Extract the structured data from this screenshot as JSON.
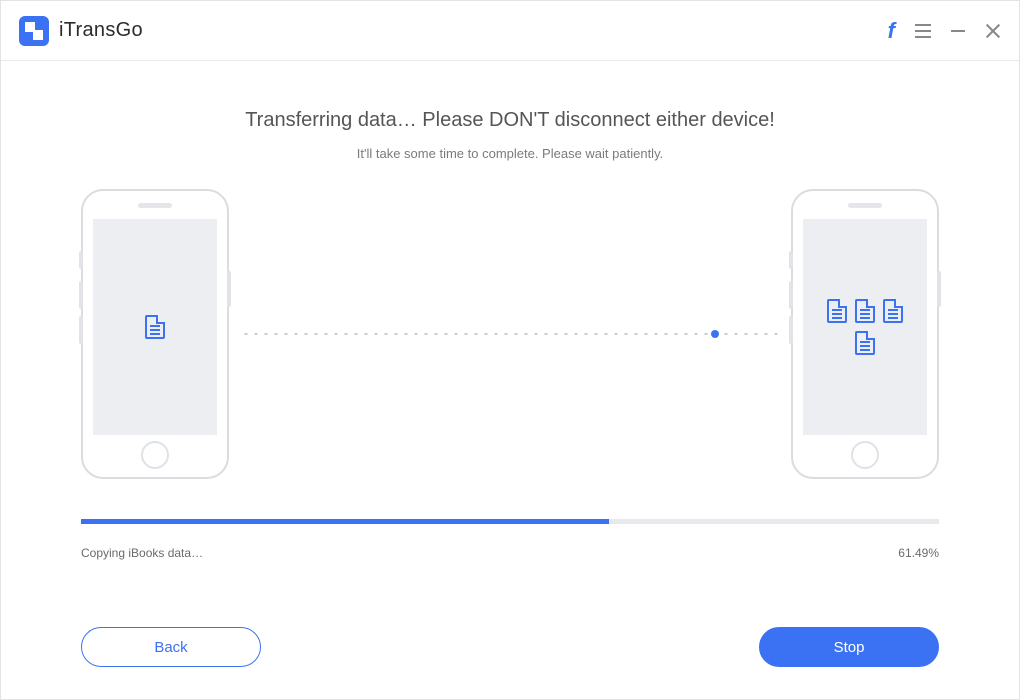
{
  "app": {
    "title": "iTransGo"
  },
  "titlebar_icons": {
    "facebook": "facebook",
    "menu": "menu",
    "minimize": "minimize",
    "close": "close"
  },
  "main": {
    "heading": "Transferring data… Please DON'T disconnect either device!",
    "subheading": "It'll take some time to complete. Please wait patiently."
  },
  "progress": {
    "status_text": "Copying iBooks data…",
    "percent_value": 61.49,
    "percent_text": "61.49%",
    "fill_width": "61.49%"
  },
  "buttons": {
    "back": "Back",
    "stop": "Stop"
  },
  "colors": {
    "accent": "#3b72f3"
  },
  "devices": {
    "source_icon": "document",
    "target_icons": [
      "document",
      "document",
      "document",
      "document"
    ]
  }
}
